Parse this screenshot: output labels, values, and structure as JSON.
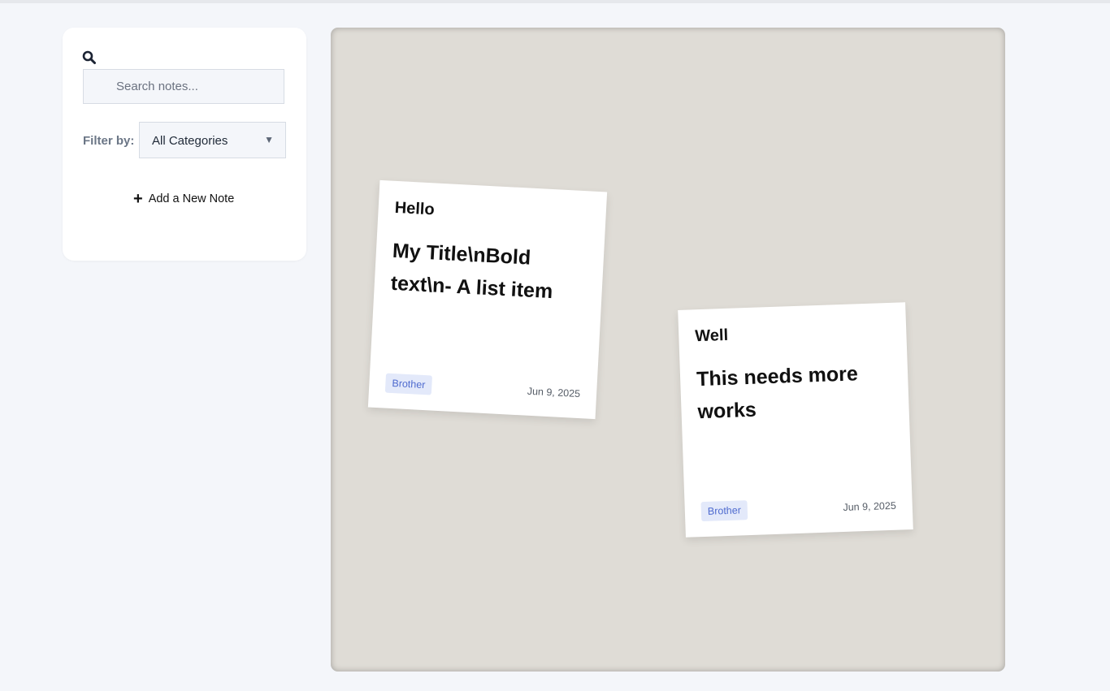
{
  "sidebar": {
    "search_placeholder": "Search notes...",
    "search_value": "",
    "filter_label": "Filter by:",
    "filter_selected": "All Categories",
    "add_note_label": "Add a New Note",
    "add_note_icon": "plus-icon",
    "search_icon": "search-icon"
  },
  "notes": [
    {
      "title": "Hello",
      "body": "My Title\\nBold text\\n- A list item",
      "tag": "Brother",
      "date": "Jun 9, 2025"
    },
    {
      "title": "Well",
      "body": "This needs more works",
      "tag": "Brother",
      "date": "Jun 9, 2025"
    }
  ],
  "colors": {
    "page_bg": "#f4f6fa",
    "board_bg": "#dfdcd6",
    "tag_bg": "#e3e9fa",
    "tag_text": "#4f6bcf"
  }
}
